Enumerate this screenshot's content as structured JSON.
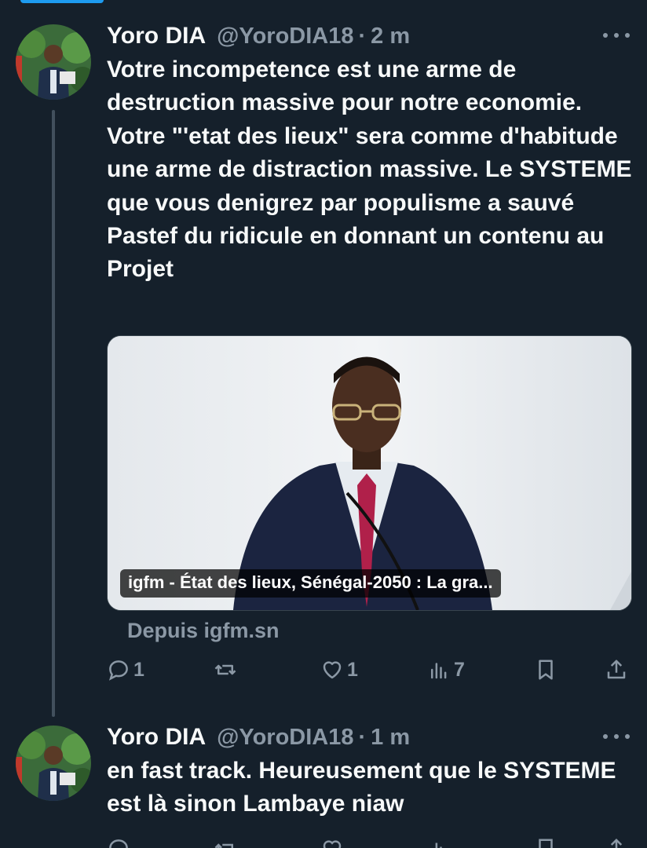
{
  "tweets": [
    {
      "name": "Yoro DIA",
      "handle": "@YoroDIA18",
      "separator": "·",
      "time": "2 m",
      "text": "Votre incompetence est une arme de destruction massive pour notre economie. Votre \"'etat des lieux\" sera comme d'habitude une arme de distraction massive. Le SYSTEME que vous denigrez par populisme a sauvé Pastef du ridicule en donnant un contenu au Projet",
      "card": {
        "caption": "igfm - État des lieux, Sénégal-2050 : La gra...",
        "source": "Depuis igfm.sn"
      },
      "actions": {
        "replies": "1",
        "reposts": "",
        "likes": "1",
        "views": "7"
      }
    },
    {
      "name": "Yoro DIA",
      "handle": "@YoroDIA18",
      "separator": "·",
      "time": "1 m",
      "text": "en fast track. Heureusement que le SYSTEME est là sinon Lambaye niaw"
    }
  ],
  "icons": {
    "reply": "reply-icon",
    "repost": "repost-icon",
    "like": "heart-icon",
    "views": "views-icon",
    "bookmark": "bookmark-icon",
    "share": "share-icon",
    "more": "more-icon"
  },
  "colors": {
    "background": "#15202b",
    "text": "#f7f9f9",
    "secondary": "#8b98a5",
    "accent": "#1d9bf0"
  }
}
